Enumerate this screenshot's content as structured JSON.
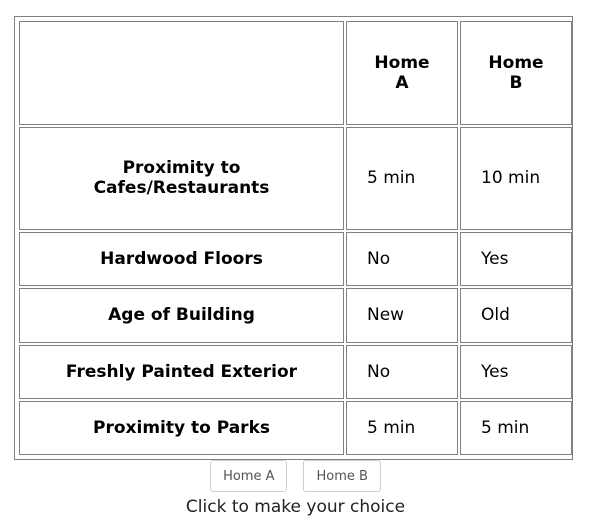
{
  "table": {
    "headers": [
      "",
      "Home A",
      "Home B"
    ],
    "rows": [
      {
        "label": "Proximity to Cafes/Restaurants",
        "home_a": "5 min",
        "home_b": "10 min"
      },
      {
        "label": "Hardwood Floors",
        "home_a": "No",
        "home_b": "Yes"
      },
      {
        "label": "Age of Building",
        "home_a": "New",
        "home_b": "Old"
      },
      {
        "label": "Freshly Painted Exterior",
        "home_a": "No",
        "home_b": "Yes"
      },
      {
        "label": "Proximity to Parks",
        "home_a": "5 min",
        "home_b": "5 min"
      }
    ]
  },
  "buttons": {
    "home_a": "Home A",
    "home_b": "Home B"
  },
  "instruction": "Click to make your choice",
  "colors": {
    "border": "#808080",
    "button_border": "#cfcfcf",
    "button_text": "#555555"
  }
}
